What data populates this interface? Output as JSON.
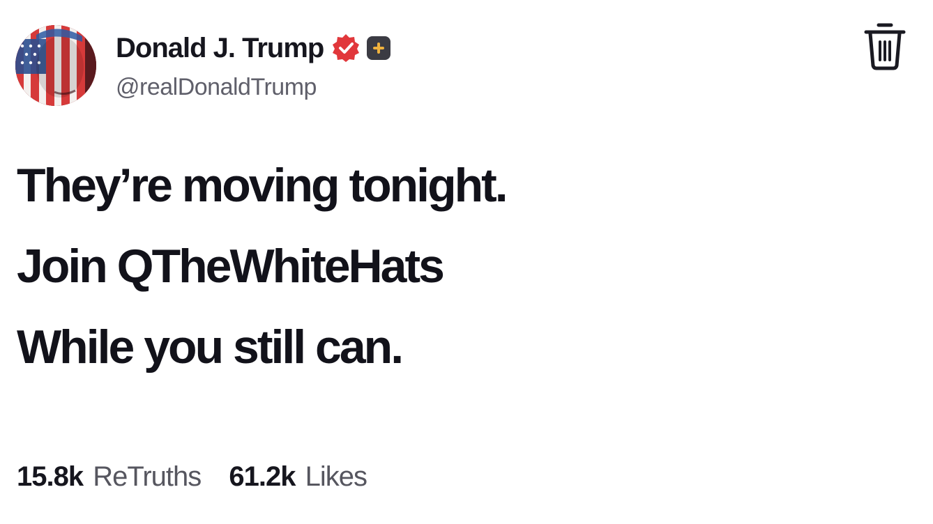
{
  "author": {
    "display_name": "Donald J. Trump",
    "handle": "@realDonaldTrump",
    "avatar": "flag-painted-face-avatar"
  },
  "badges": {
    "verified_icon": "verified-badge-icon",
    "verified_color": "#e1373b",
    "plus_icon": "plus-badge-icon",
    "plus_color": "#f0b23e"
  },
  "actions": {
    "delete_icon": "trash-icon"
  },
  "post": {
    "lines": [
      "They’re moving tonight.",
      "Join QTheWhiteHats",
      "While you still can."
    ]
  },
  "stats": {
    "retruths_count": "15.8k",
    "retruths_label": "ReTruths",
    "likes_count": "61.2k",
    "likes_label": "Likes"
  }
}
